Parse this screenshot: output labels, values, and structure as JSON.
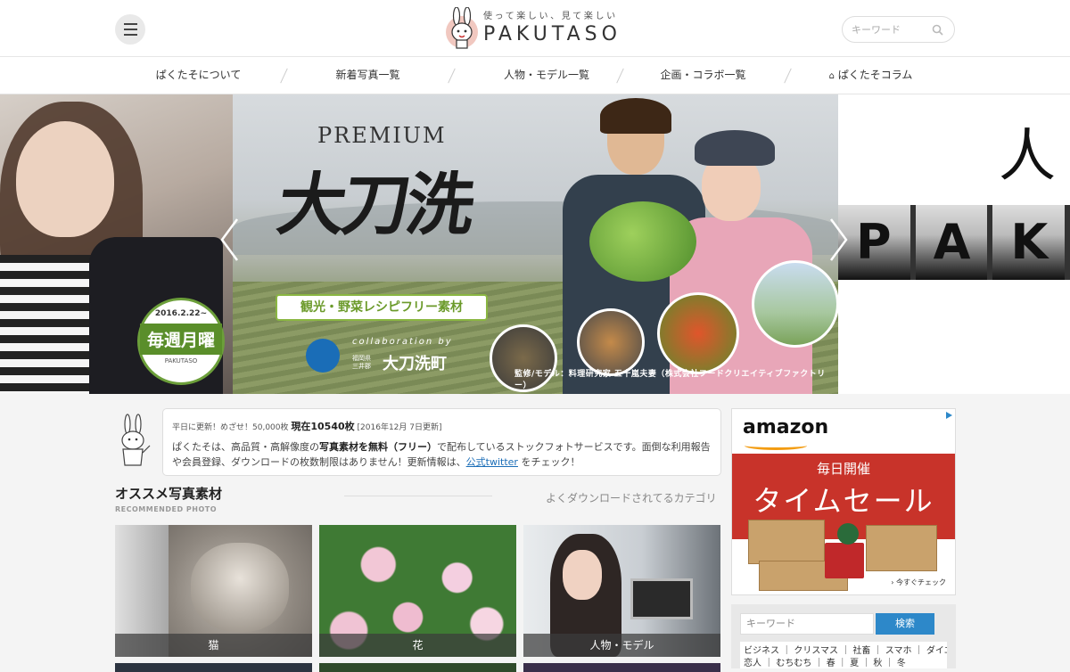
{
  "header": {
    "tagline": "使って楽しい、見て楽しい",
    "brand": "PAKUTASO",
    "search_placeholder": "キーワード"
  },
  "nav": {
    "items": [
      {
        "label": "ぱくたそについて"
      },
      {
        "label": "新着写真一覧"
      },
      {
        "label": "人物・モデル一覧"
      },
      {
        "label": "企画・コラボ一覧"
      },
      {
        "label": "ぱくたそコラム"
      }
    ]
  },
  "hero": {
    "left_badge": {
      "date": "2016.2.22~",
      "main": "毎週月曜",
      "sub": "PAKUTASO"
    },
    "main": {
      "premium": "PREMIUM",
      "title": "大刀洗",
      "ribbon": "観光・野菜レシピフリー素材",
      "collab_label": "collaboration by",
      "collab_pref": "福岡県 三井郡",
      "collab_town": "大刀洗町",
      "credit": "監修/モデル：料理研究家 五十嵐夫妻（株式会社フードクリエイティブファクトリー）"
    },
    "right": {
      "kanji": "人",
      "letters": [
        "P",
        "A",
        "K"
      ]
    }
  },
  "notice": {
    "prefix": "平日に更新！めざせ！50,000枚",
    "count": "現在10540枚",
    "date": "[2016年12月 7日更新]",
    "body_1": "ぱくたそは、高品質・高解像度の",
    "body_strong": "写真素材を無料（フリー）",
    "body_2": "で配布しているストックフォトサービスです。面倒な利用報告や会員登録、ダウンロードの枚数制限はありません！更新情報は、",
    "link": "公式twitter",
    "body_3": "をチェック！"
  },
  "recommended": {
    "title": "オススメ写真素材",
    "subtitle": "RECOMMENDED PHOTO",
    "popular_link": "よくダウンロードされてるカテゴリ",
    "cards": [
      {
        "label": "猫"
      },
      {
        "label": "花"
      },
      {
        "label": "人物・モデル"
      }
    ]
  },
  "ad": {
    "brand": "amazon",
    "line1": "毎日開催",
    "line2": "タイムセール",
    "cta": "› 今すぐチェック"
  },
  "sidebar": {
    "search_placeholder": "キーワード",
    "search_button": "検索",
    "tags_line1": "ビジネス ｜ クリスマス ｜ 社畜 ｜ スマホ ｜ ダイエット",
    "tags_line2": "恋人 ｜ むちむち ｜ 春 ｜ 夏 ｜ 秋 ｜ 冬"
  },
  "colors": {
    "accent": "#2d88c9",
    "ribbon_green": "#6b9a2a",
    "ad_red": "#c8332a"
  }
}
